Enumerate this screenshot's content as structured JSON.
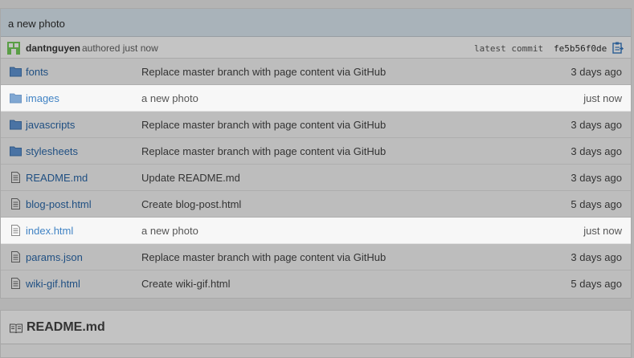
{
  "commit": {
    "title": "a new photo",
    "author": "dantnguyen",
    "authored_text": "authored just now",
    "latest_label": "latest commit",
    "sha": "fe5b56f0de"
  },
  "files": [
    {
      "name": "fonts",
      "type": "folder",
      "message": "Replace master branch with page content via GitHub",
      "age": "3 days ago"
    },
    {
      "name": "images",
      "type": "folder",
      "message": "a new photo",
      "age": "just now"
    },
    {
      "name": "javascripts",
      "type": "folder",
      "message": "Replace master branch with page content via GitHub",
      "age": "3 days ago"
    },
    {
      "name": "stylesheets",
      "type": "folder",
      "message": "Replace master branch with page content via GitHub",
      "age": "3 days ago"
    },
    {
      "name": "README.md",
      "type": "file",
      "message": "Update README.md",
      "age": "3 days ago"
    },
    {
      "name": "blog-post.html",
      "type": "file",
      "message": "Create blog-post.html",
      "age": "5 days ago"
    },
    {
      "name": "index.html",
      "type": "file",
      "message": "a new photo",
      "age": "just now"
    },
    {
      "name": "params.json",
      "type": "file",
      "message": "Replace master branch with page content via GitHub",
      "age": "3 days ago"
    },
    {
      "name": "wiki-gif.html",
      "type": "file",
      "message": "Create wiki-gif.html",
      "age": "5 days ago"
    }
  ],
  "readme": {
    "title": "README.md"
  },
  "icons": {
    "folder": "folder-icon",
    "file": "file-icon",
    "clipboard": "clipboard-icon",
    "book": "book-icon",
    "avatar": "avatar"
  },
  "colors": {
    "link": "#1f4f82",
    "link_highlight": "#4183c4",
    "row_highlight": "#f7f7f7"
  }
}
